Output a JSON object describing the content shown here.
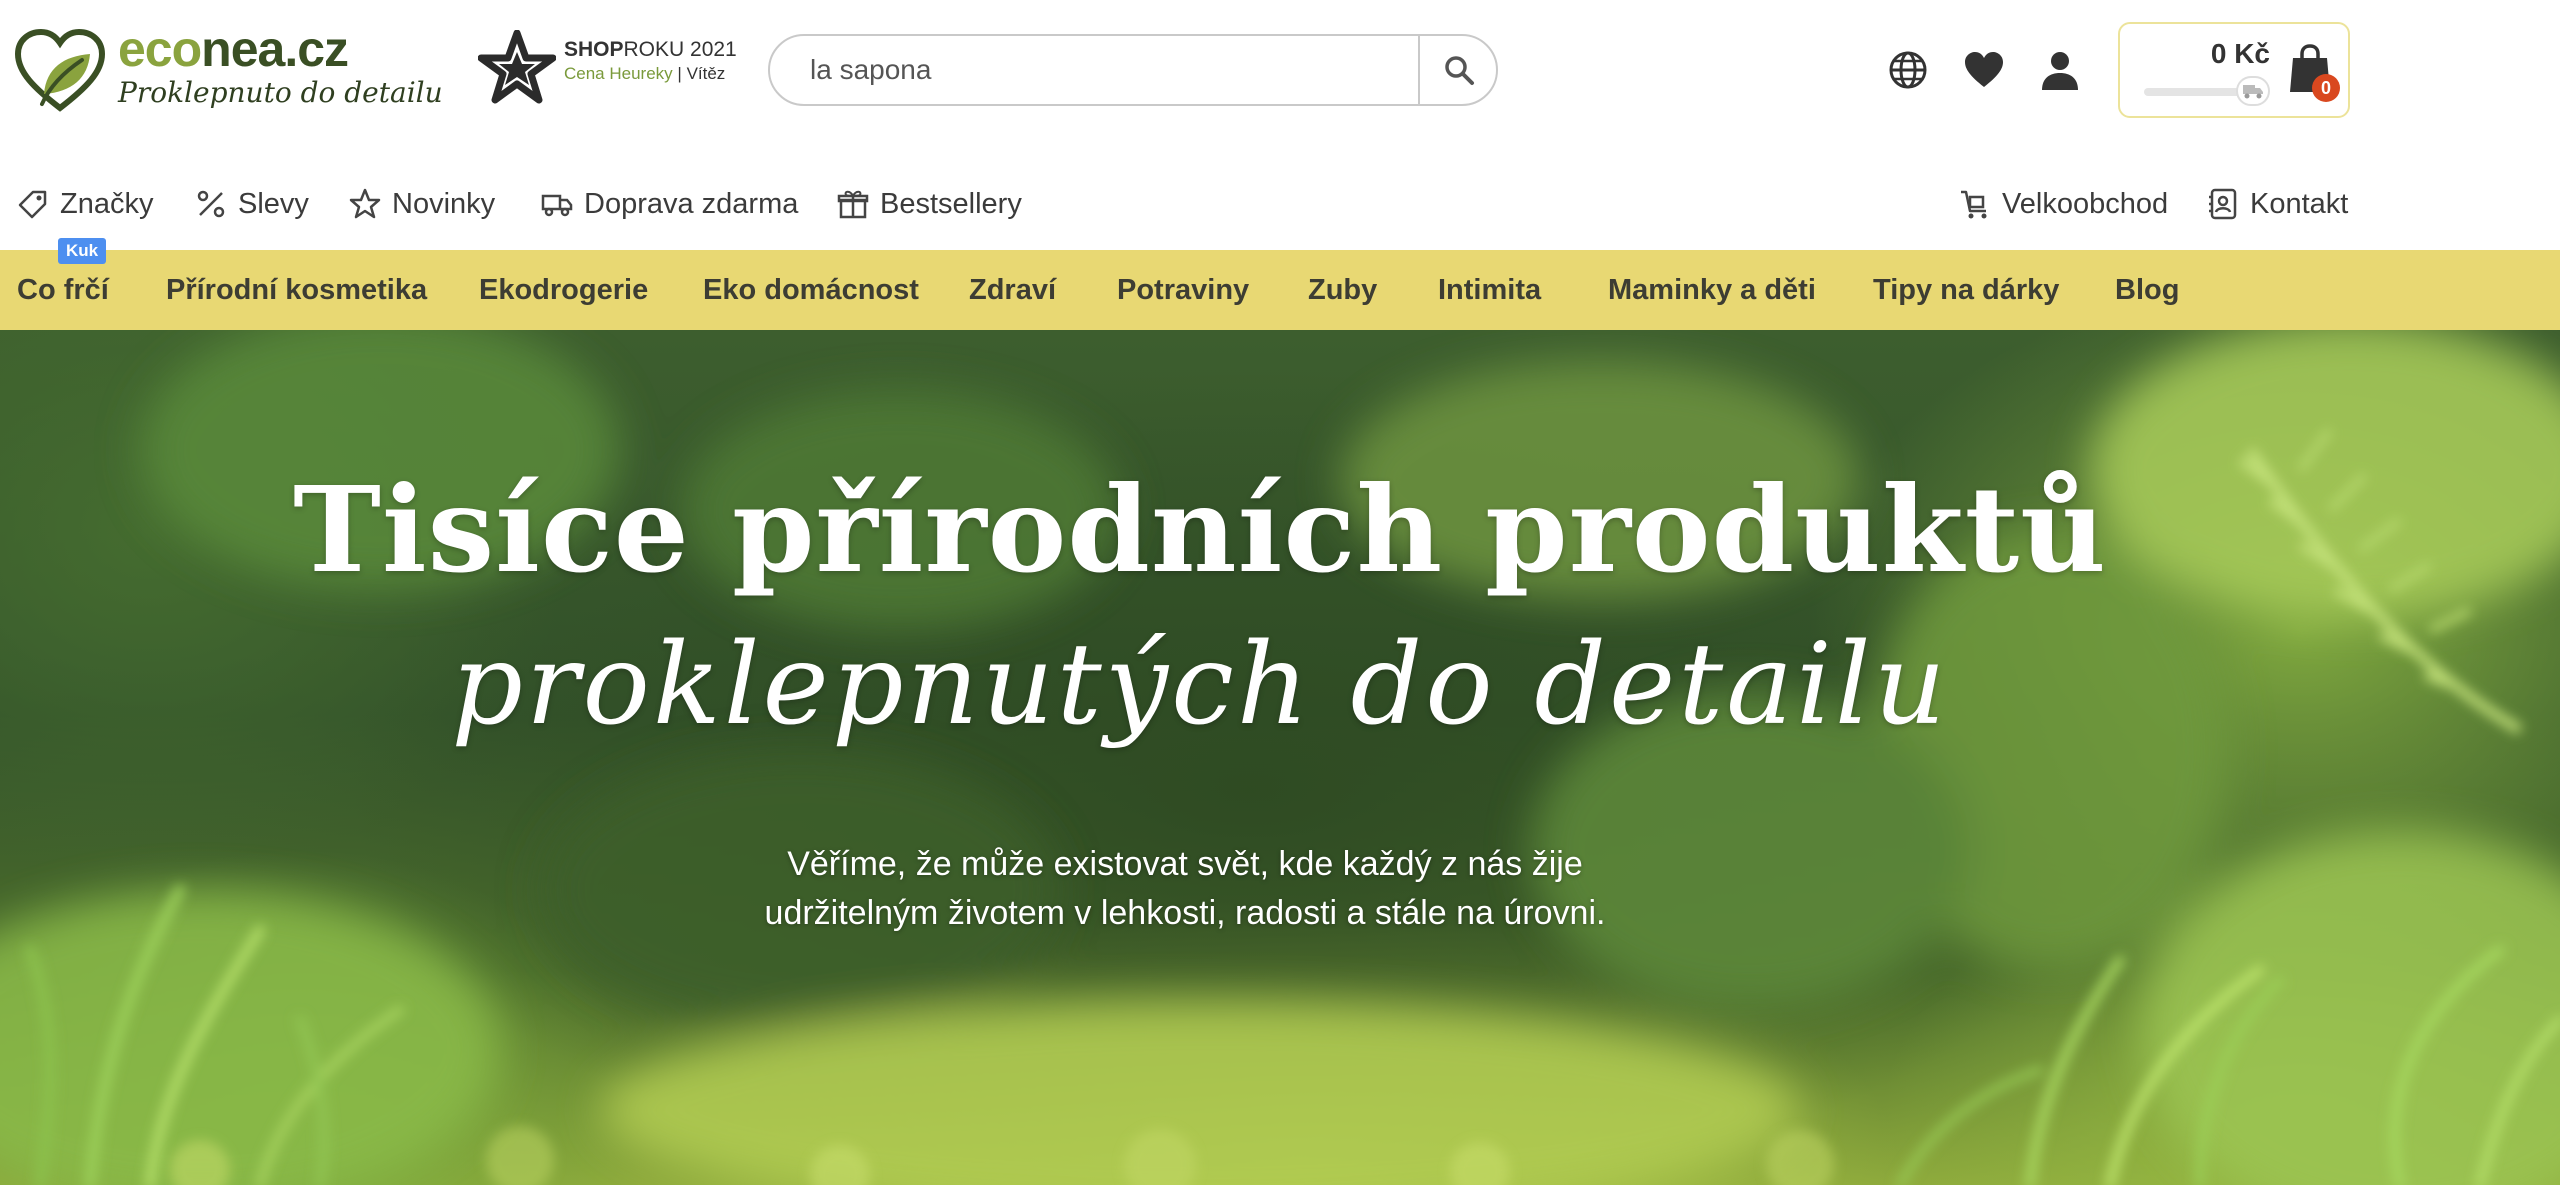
{
  "brand": {
    "name_part1": "eco",
    "name_part2": "nea.cz",
    "tagline": "Proklepnuto do detailu",
    "colors": {
      "leaf_green": "#8aa33e",
      "dark_green": "#3a4f24",
      "menu_yellow": "#e8d873",
      "badge_red": "#d9481f",
      "kuk_blue": "#4d8ff0"
    }
  },
  "award": {
    "title_bold": "SHOP",
    "title_rest": "ROKU 2021",
    "sub": "Cena Heureky",
    "sep": "|",
    "win": "Vítěz",
    "icon": "star-badge-icon"
  },
  "search": {
    "value": "la sapona",
    "icon": "search-icon"
  },
  "header_icons": [
    "globe-icon",
    "heart-icon",
    "user-icon"
  ],
  "cart": {
    "price": "0 Kč",
    "count": "0",
    "shipping_progress": 0
  },
  "subnav": {
    "left": [
      {
        "label": "Značky",
        "icon": "tag-icon"
      },
      {
        "label": "Slevy",
        "icon": "percent-icon"
      },
      {
        "label": "Novinky",
        "icon": "star-icon"
      },
      {
        "label": "Doprava zdarma",
        "icon": "truck-icon"
      },
      {
        "label": "Bestsellery",
        "icon": "gift-icon"
      }
    ],
    "right": [
      {
        "label": "Velkoobchod",
        "icon": "cart-icon"
      },
      {
        "label": "Kontakt",
        "icon": "contact-icon"
      }
    ]
  },
  "menu": {
    "badge": "Kuk",
    "items": [
      "Co frčí",
      "Přírodní kosmetika",
      "Ekodrogerie",
      "Eko domácnost",
      "Zdraví",
      "Potraviny",
      "Zuby",
      "Intimita",
      "Maminky a děti",
      "Tipy na dárky",
      "Blog"
    ]
  },
  "hero": {
    "title": "Tisíce přírodních produktů",
    "script": "proklepnutých do detailu",
    "text_line1": "Věříme, že může existovat svět, kde každý z nás žije",
    "text_line2": "udržitelným životem v lehkosti, radosti a stále na úrovni."
  }
}
